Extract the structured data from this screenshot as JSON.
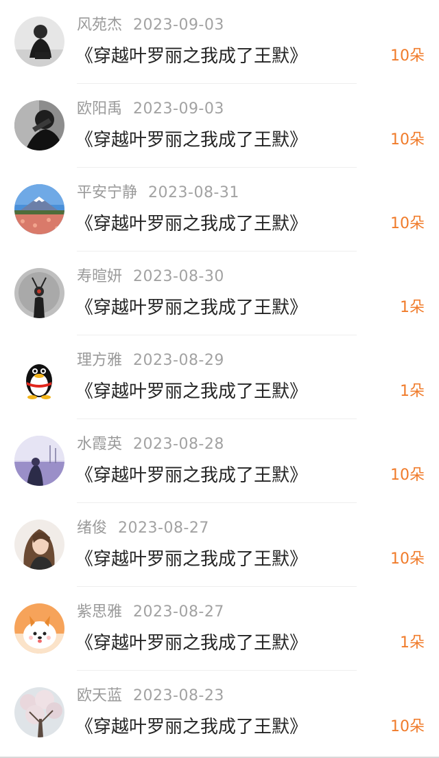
{
  "list": {
    "items": [
      {
        "name": "风苑杰",
        "date": "2023-09-03",
        "title": "《穿越叶罗丽之我成了王默》",
        "amount": "10朵",
        "avatar_icon": "person-dark-clothes-avatar"
      },
      {
        "name": "欧阳禹",
        "date": "2023-09-03",
        "title": "《穿越叶罗丽之我成了王默》",
        "amount": "10朵",
        "avatar_icon": "bw-portrait-avatar"
      },
      {
        "name": "平安宁静",
        "date": "2023-08-31",
        "title": "《穿越叶罗丽之我成了王默》",
        "amount": "10朵",
        "avatar_icon": "mount-fuji-flowers-avatar"
      },
      {
        "name": "寿暄妍",
        "date": "2023-08-30",
        "title": "《穿越叶罗丽之我成了王默》",
        "amount": "1朵",
        "avatar_icon": "dark-figure-avatar"
      },
      {
        "name": "理方雅",
        "date": "2023-08-29",
        "title": "《穿越叶罗丽之我成了王默》",
        "amount": "1朵",
        "avatar_icon": "qq-penguin-avatar"
      },
      {
        "name": "水霞英",
        "date": "2023-08-28",
        "title": "《穿越叶罗丽之我成了王默》",
        "amount": "10朵",
        "avatar_icon": "purple-scene-avatar"
      },
      {
        "name": "绪俊",
        "date": "2023-08-27",
        "title": "《穿越叶罗丽之我成了王默》",
        "amount": "10朵",
        "avatar_icon": "woman-portrait-avatar"
      },
      {
        "name": "紫思雅",
        "date": "2023-08-27",
        "title": "《穿越叶罗丽之我成了王默》",
        "amount": "1朵",
        "avatar_icon": "cartoon-dog-avatar"
      },
      {
        "name": "欧天蓝",
        "date": "2023-08-23",
        "title": "《穿越叶罗丽之我成了王默》",
        "amount": "10朵",
        "avatar_icon": "blossom-tree-avatar"
      }
    ]
  }
}
